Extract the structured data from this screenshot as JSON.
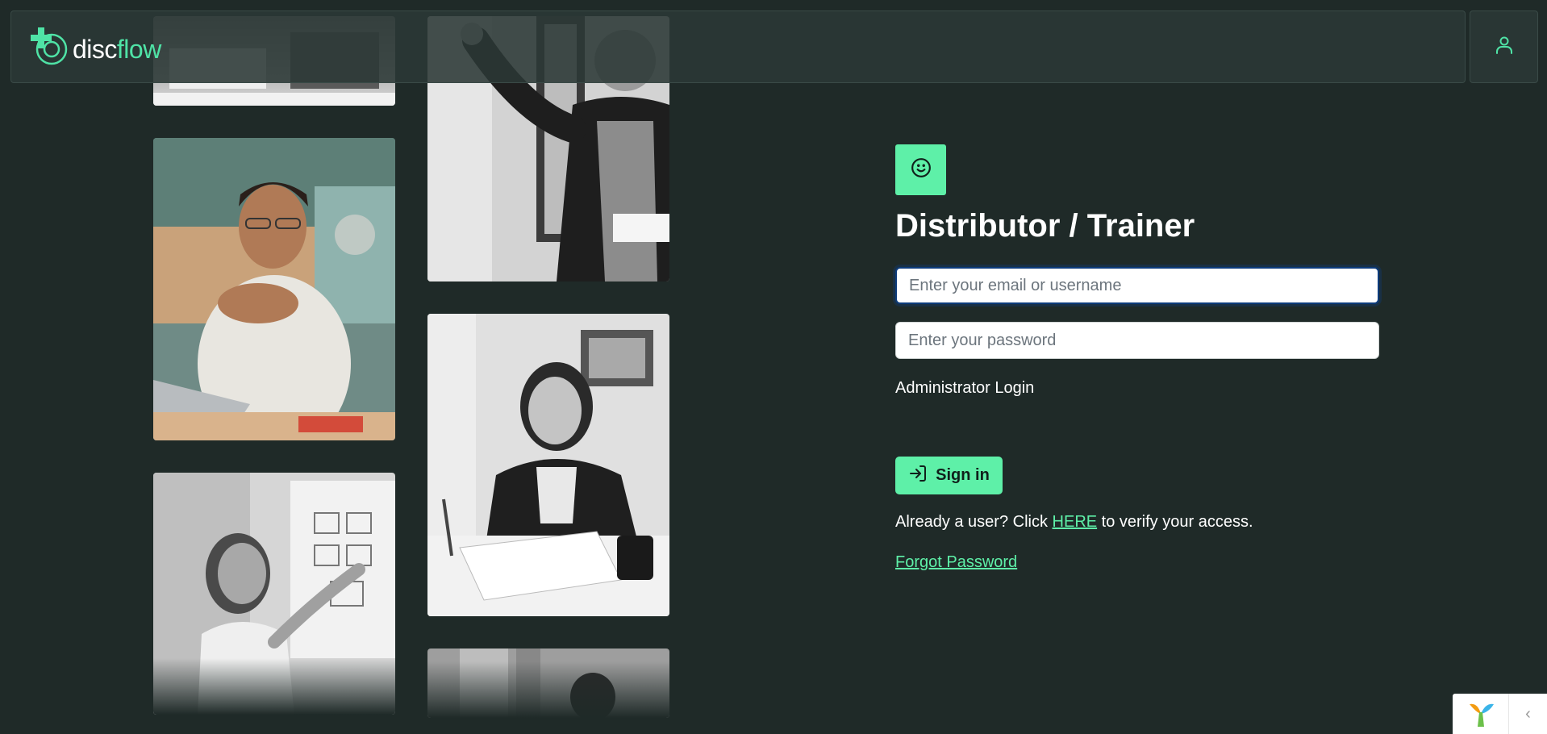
{
  "header": {
    "logo": {
      "text_disc": "disc",
      "text_flow": "flow",
      "icon": "discflow-logo-icon"
    },
    "user_button": {
      "icon": "user-icon"
    }
  },
  "photos": [
    {
      "name": "photo-top-left",
      "description": "person-at-desk-grayscale"
    },
    {
      "name": "photo-man-laptop",
      "description": "man-with-glasses-at-laptop"
    },
    {
      "name": "photo-woman-whiteboard",
      "description": "woman-pointing-at-whiteboard"
    },
    {
      "name": "photo-man-writing-board",
      "description": "man-writing-on-board"
    },
    {
      "name": "photo-woman-desk",
      "description": "woman-at-desk-smiling"
    },
    {
      "name": "photo-bottom-right",
      "description": "person-partial"
    }
  ],
  "form": {
    "badge_icon": "smile-icon",
    "title": "Distributor / Trainer",
    "email_placeholder": "Enter your email or username",
    "email_value": "",
    "password_placeholder": "Enter your password",
    "password_value": "",
    "admin_login": "Administrator Login",
    "signin_label": "Sign in",
    "signin_icon": "sign-in-icon",
    "verify_prefix": "Already a user? Click ",
    "verify_link": "HERE",
    "verify_suffix": " to verify your access.",
    "forgot_password": "Forgot Password"
  },
  "widget": {
    "logo_icon": "yii-logo-icon",
    "arrow": "‹"
  },
  "colors": {
    "background": "#1f2a28",
    "accent": "#5ef0a8",
    "header": "#2b3836"
  }
}
